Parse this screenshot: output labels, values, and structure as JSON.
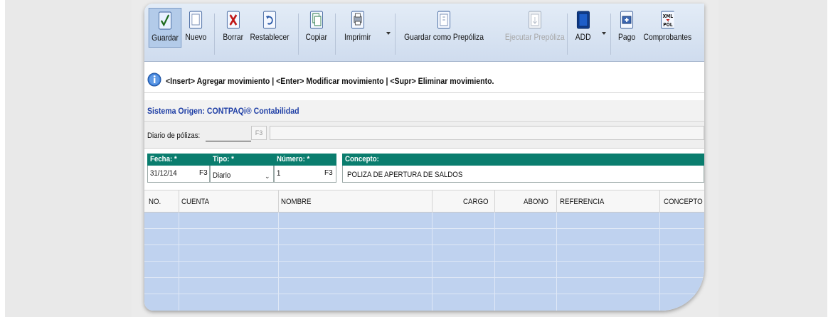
{
  "toolbar": {
    "guardar": "Guardar",
    "nuevo": "Nuevo",
    "borrar": "Borrar",
    "restablecer": "Restablecer",
    "copiar": "Copiar",
    "imprimir": "Imprimir",
    "guardar_prepoliza": "Guardar como Prepóliza",
    "ejecutar_prepoliza": "Ejecutar Prepóliza",
    "add": "ADD",
    "pago": "Pago",
    "comprobantes": "Comprobantes",
    "xml_icon_line1": "XML",
    "xml_icon_line2": "PÓL"
  },
  "info": {
    "message": "<Insert> Agregar movimiento | <Enter> Modificar movimiento | <Supr> Eliminar movimiento."
  },
  "origin": {
    "text": "Sistema Origen: CONTPAQi® Contabilidad"
  },
  "diario": {
    "label": "Diario de pólizas:",
    "f3": "F3"
  },
  "poliza": {
    "fecha_label": "Fecha: *",
    "fecha_value": "31/12/14",
    "fecha_f3": "F3",
    "tipo_label": "Tipo: *",
    "tipo_value": "Diario",
    "numero_label": "Número: *",
    "numero_value": "1",
    "numero_f3": "F3",
    "concepto_label": "Concepto:",
    "concepto_value": "POLIZA DE APERTURA DE SALDOS"
  },
  "grid": {
    "columns": [
      "NO.",
      "CUENTA",
      "NOMBRE",
      "CARGO",
      "ABONO",
      "REFERENCIA",
      "CONCEPTO"
    ]
  },
  "colors": {
    "header_green": "#0a7d6e",
    "grid_blue": "#bfd2ef",
    "origin_blue": "#1f3fa6"
  }
}
